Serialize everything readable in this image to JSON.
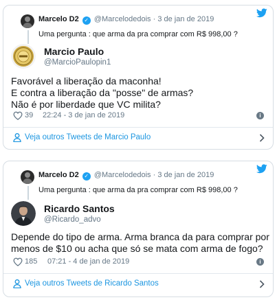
{
  "colors": {
    "link": "#1b95e0",
    "verified": "#1da1f2",
    "muted": "#657786",
    "text": "#14171a"
  },
  "tweets": [
    {
      "quoted": {
        "name": "Marcelo D2",
        "handle": "@Marcelodedois",
        "sep": "·",
        "date": "3 de jan de 2019",
        "text": "Uma pergunta : que arma da pra comprar com R$ 998,00 ?"
      },
      "author": {
        "name": "Marcio Paulo",
        "handle": "@MarcioPaulopin1"
      },
      "lines": [
        "Favorável a liberação da maconha!",
        "E contra a liberação da \"posse\" de armas?",
        "Não é por liberdade que VC milita?"
      ],
      "likes": "39",
      "timestamp": "22:24 - 3 de jan de 2019",
      "footer": "Veja outros Tweets de Marcio Paulo"
    },
    {
      "quoted": {
        "name": "Marcelo D2",
        "handle": "@Marcelodedois",
        "sep": "·",
        "date": "3 de jan de 2019",
        "text": "Uma pergunta : que arma da pra comprar com R$ 998,00 ?"
      },
      "author": {
        "name": "Ricardo Santos",
        "handle": "@Ricardo_advo"
      },
      "lines": [
        "Depende do tipo de arma. Arma branca da para comprar por",
        "menos de $10 ou acha que só se mata com arma de fogo?"
      ],
      "likes": "185",
      "timestamp": "07:21 - 4 de jan de 2019",
      "footer": "Veja outros Tweets de Ricardo Santos"
    }
  ]
}
